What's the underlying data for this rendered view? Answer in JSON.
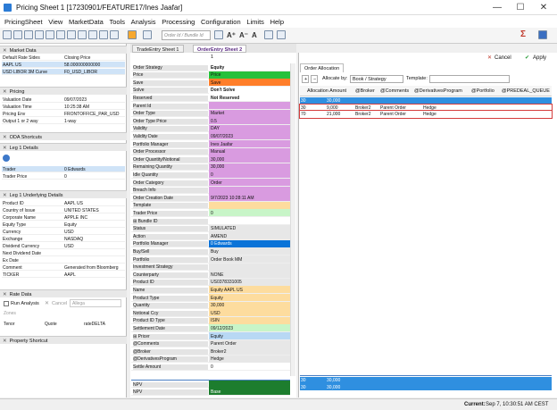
{
  "window": {
    "title": "Pricing Sheet 1 [17230901/FEATURE17/Ines Jaafar]",
    "min": "—",
    "max": "☐",
    "close": "✕"
  },
  "menu": [
    "PricingSheet",
    "View",
    "MarketData",
    "Tools",
    "Analysis",
    "Processing",
    "Configuration",
    "Limits",
    "Help"
  ],
  "toolbar": {
    "search_placeholder": "Order Id / Bundle Id",
    "sigma": "Σ"
  },
  "left": {
    "market_data": {
      "title": "Market Data",
      "rows": [
        {
          "k": "Default Rate Sides",
          "v": "Closing Price"
        },
        {
          "k": "AAPL US",
          "v": "58.000000000000"
        },
        {
          "k": "USD LIBOR 3M Curve",
          "v": "F0_USD_LIBOR"
        }
      ]
    },
    "pricing": {
      "title": "Pricing",
      "rows": [
        {
          "k": "Valuation Date",
          "v": "09/07/2023"
        },
        {
          "k": "Valuation Time",
          "v": "10:25:38 AM"
        },
        {
          "k": "Pricing Env",
          "v": "FRONTOFFICE_PAR_USD"
        },
        {
          "k": "Output 1 or 2 way",
          "v": "1-way"
        }
      ]
    },
    "oda_title": "ODA Shortcuts",
    "leg1": {
      "title": "Leg 1 Details",
      "rows": [
        {
          "k": "Trader",
          "v": "0 Edwards"
        },
        {
          "k": "Trader Price",
          "v": "0"
        }
      ]
    },
    "leg1u": {
      "title": "Leg 1 Underlying Details",
      "rows": [
        {
          "k": "Product ID",
          "v": "AAPL US"
        },
        {
          "k": "Country of Issue",
          "v": "UNITED STATES"
        },
        {
          "k": "Corporate Name",
          "v": "APPLE INC"
        },
        {
          "k": "Equity Type",
          "v": "Equity"
        },
        {
          "k": "Currency",
          "v": "USD"
        },
        {
          "k": "Exchange",
          "v": "NASDAQ"
        },
        {
          "k": "Dividend Currency",
          "v": "USD"
        },
        {
          "k": "Next Dividend Date",
          "v": ""
        },
        {
          "k": "Ex Date",
          "v": ""
        },
        {
          "k": "Comment",
          "v": "Generated from Bloomberg"
        },
        {
          "k": "TICKER",
          "v": "AAPL"
        }
      ]
    },
    "rate_title": "Rate Data",
    "rate": {
      "run_analysis": "Run Analysis",
      "cancel": "Cancel",
      "select": "Allega",
      "zones": "Zones",
      "cols": [
        "Tenor",
        "Quote",
        "rateDELTA"
      ]
    },
    "prop_title": "Property Shortcut"
  },
  "tabs": [
    {
      "label": "TradeEntry Sheet 1"
    },
    {
      "label": "OrderEntry Sheet 2"
    }
  ],
  "order_index": "1",
  "order_rows": [
    {
      "k": "Order Strategy",
      "v": "Equity",
      "c": "#fff",
      "bold": true
    },
    {
      "k": "Price",
      "v": "Price",
      "c": "#25c13b"
    },
    {
      "k": "Save",
      "v": "Save",
      "c": "#ff7e2a"
    },
    {
      "k": "Solve",
      "v": "Don't Solve",
      "c": "#fff",
      "bold": true
    },
    {
      "k": "Reserved",
      "v": "Not Reserved",
      "c": "#fff",
      "bold": true
    },
    {
      "k": "Parent Id",
      "v": "",
      "c": "#d99be0"
    },
    {
      "k": "Order Type",
      "v": "Market",
      "c": "#d99be0"
    },
    {
      "k": "Order Type Price",
      "v": "0.5",
      "c": "#d99be0"
    },
    {
      "k": "Validity",
      "v": "DAY",
      "c": "#d99be0"
    },
    {
      "k": "Validity Date",
      "v": "09/07/2023",
      "c": "#d99be0"
    },
    {
      "k": "Portfolio Manager",
      "v": "Ines Jaafar",
      "c": "#d99be0"
    },
    {
      "k": "Order Processor",
      "v": "Manual",
      "c": "#d99be0"
    },
    {
      "k": "Order Quantity/Notional",
      "v": "30,000",
      "c": "#d99be0"
    },
    {
      "k": "Remaining Quantity",
      "v": "30,000",
      "c": "#d99be0"
    },
    {
      "k": "Idle Quantity",
      "v": "0",
      "c": "#d99be0"
    },
    {
      "k": "Order Category",
      "v": "Order",
      "c": "#d99be0"
    },
    {
      "k": "Breach Info",
      "v": "",
      "c": "#d99be0"
    },
    {
      "k": "Order Creation Date",
      "v": "9/7/2023 10:28:11 AM",
      "c": "#d99be0"
    },
    {
      "k": "Template",
      "v": "",
      "c": "#fddc9e"
    },
    {
      "k": "Trader Price",
      "v": "0",
      "c": "#c8f5c8"
    },
    {
      "k": "⊞ Bundle ID",
      "v": "",
      "c": "#fff"
    },
    {
      "k": "Status",
      "v": "SIMULATED",
      "c": "#e7e7e7"
    },
    {
      "k": "Action",
      "v": "AMEND",
      "c": "#e7e7e7"
    },
    {
      "k": "Portfolio Manager",
      "v": "0 Edwards",
      "c": "#0a73d8",
      "white": true
    },
    {
      "k": "Buy/Sell",
      "v": "Buy",
      "c": "#e7e7e7"
    },
    {
      "k": "Portfolio",
      "v": "Order Book MM",
      "c": "#e7e7e7"
    },
    {
      "k": "Investment Strategy",
      "v": "",
      "c": "#e7e7e7"
    },
    {
      "k": "Counterparty",
      "v": "NONE",
      "c": "#e7e7e7"
    },
    {
      "k": "Product ID",
      "v": "US0378331005",
      "c": "#e7e7e7"
    },
    {
      "k": "Name",
      "v": "Equity AAPL US",
      "c": "#fddc9e"
    },
    {
      "k": "Product Type",
      "v": "Equity",
      "c": "#fddc9e"
    },
    {
      "k": "Quantity",
      "v": "30,000",
      "c": "#fddc9e"
    },
    {
      "k": "Notional Ccy",
      "v": "USD",
      "c": "#fddc9e"
    },
    {
      "k": "Product ID Type",
      "v": "ISIN",
      "c": "#fddc9e"
    },
    {
      "k": "Settlement Date",
      "v": "09/12/2023",
      "c": "#c8f5c8"
    },
    {
      "k": "⊞ Pricer",
      "v": "Equity",
      "c": "#b8d8f4"
    },
    {
      "k": "@Comments",
      "v": "Parent Order",
      "c": "#e7e7e7"
    },
    {
      "k": "@Broker",
      "v": "Broker2",
      "c": "#e7e7e7"
    },
    {
      "k": "@DerivativesProgram",
      "v": "Hedge",
      "c": "#e7e7e7"
    },
    {
      "k": "Settle Amount",
      "v": "0",
      "c": "#fff"
    }
  ],
  "npv_rows": [
    {
      "k": "NPV",
      "v": ""
    },
    {
      "k": "NPV",
      "v": "Base"
    }
  ],
  "right": {
    "cancel": "Cancel",
    "apply": "Apply",
    "tab": "Order Allocation",
    "allocate_by": "Allocate by:",
    "allocate_sel": "Book / Strategy",
    "template": "Template:",
    "headers": [
      "Allocation Amount",
      "@Broker",
      "@Comments",
      "@DerivativesProgram",
      "@Portfolio",
      "@PREDEAL_QUEUE"
    ],
    "rows": [
      {
        "id": "30",
        "amount": "30,000",
        "broker": "",
        "comments": "",
        "prog": "",
        "c": "#2f8fe0"
      },
      {
        "id": "30",
        "amount": "9,000",
        "broker": "Broker2",
        "comments": "Parent Order",
        "prog": "Hedge",
        "c": "#fff",
        "outline": true
      },
      {
        "id": "70",
        "amount": "21,000",
        "broker": "Broker2",
        "comments": "Parent Order",
        "prog": "Hedge",
        "c": "#fff",
        "outline": true
      }
    ],
    "bottom": [
      {
        "id": "30",
        "amount": "30,000"
      },
      {
        "id": "30",
        "amount": "30,000"
      }
    ]
  },
  "status": {
    "current": "Current:",
    "value": "Sep 7, 10:30:51 AM CEST"
  }
}
